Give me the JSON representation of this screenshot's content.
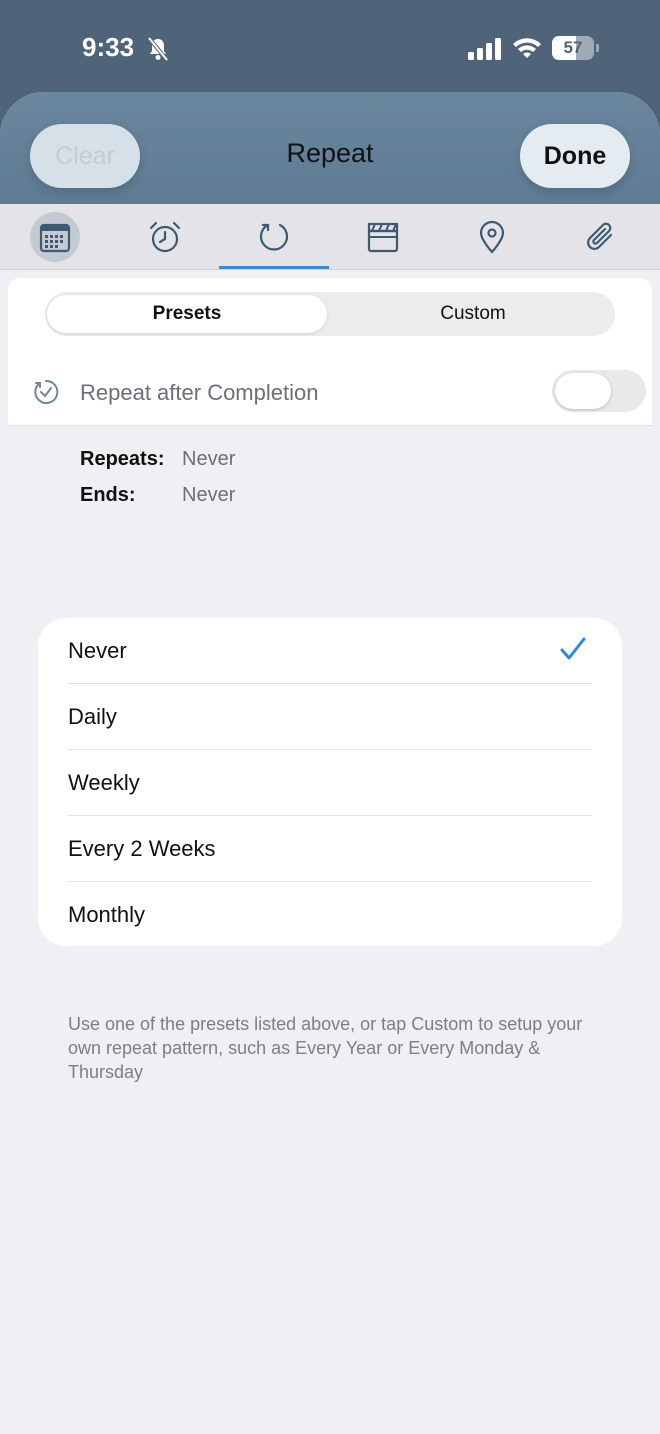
{
  "status_bar": {
    "time": "9:33",
    "battery_level": "57",
    "battery_fraction": 0.57,
    "icons": [
      "bell-slash-icon",
      "cellular-signal-icon",
      "wifi-icon",
      "battery-icon"
    ]
  },
  "header": {
    "title": "Repeat",
    "clear_label": "Clear",
    "done_label": "Done"
  },
  "tabs": [
    {
      "icon": "calendar-icon",
      "active_highlight": true
    },
    {
      "icon": "alarm-clock-icon"
    },
    {
      "icon": "repeat-icon",
      "selected": true
    },
    {
      "icon": "clapperboard-icon"
    },
    {
      "icon": "location-pin-icon"
    },
    {
      "icon": "paperclip-icon"
    }
  ],
  "segmented": {
    "presets_label": "Presets",
    "custom_label": "Custom",
    "selected": "Presets"
  },
  "repeat_after_completion": {
    "label": "Repeat after Completion",
    "enabled": false
  },
  "summary": {
    "repeats_label": "Repeats:",
    "repeats_value": "Never",
    "ends_label": "Ends:",
    "ends_value": "Never"
  },
  "options": [
    {
      "label": "Never",
      "checked": true
    },
    {
      "label": "Daily"
    },
    {
      "label": "Weekly"
    },
    {
      "label": "Every 2 Weeks"
    },
    {
      "label": "Monthly"
    }
  ],
  "footnote": "Use one of the presets listed above, or tap Custom to setup your own repeat pattern, such as Every Year or Every Monday & Thursday",
  "colors": {
    "accent": "#2f8ae6",
    "header_bg": "#5e7b93",
    "status_bg": "#4f6478"
  }
}
